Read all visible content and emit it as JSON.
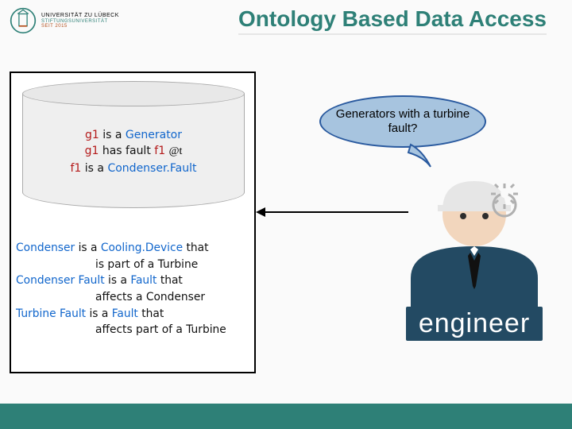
{
  "header": {
    "uni_line": "UNIVERSITÄT ZU LÜBECK",
    "sub1": "STIFTUNGSUNIVERSITÄT",
    "sub2": "SEIT 2015",
    "title": "Ontology Based Data Access"
  },
  "db": {
    "t1": {
      "s": "g1",
      "p": "is a",
      "o": "Generator"
    },
    "t2": {
      "s": "g1",
      "p": "has fault",
      "o": "f1",
      "annot": "@t"
    },
    "t3": {
      "s": "f1",
      "p": "is a",
      "o": "Condenser.Fault"
    }
  },
  "defs": {
    "d1": {
      "s": "Condenser",
      "p": "is a",
      "o": "Cooling.Device",
      "tail": "is part of a Turbine"
    },
    "d2": {
      "s": "Condenser Fault",
      "p": "is a",
      "o": "Fault",
      "tail": "affects a Condenser"
    },
    "d3": {
      "s": "Turbine Fault",
      "p": "is a",
      "o": "Fault",
      "tail": "affects part of a Turbine"
    }
  },
  "query": {
    "text": "Generators with a turbine fault?"
  },
  "engineer": {
    "label": "engineer"
  }
}
